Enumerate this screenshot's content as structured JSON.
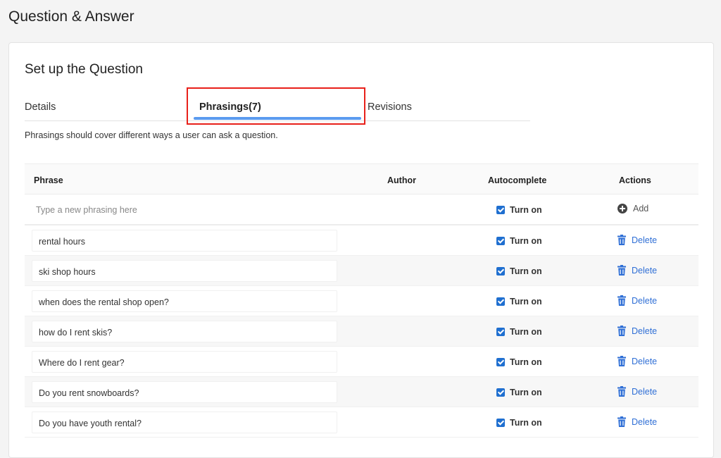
{
  "page": {
    "title": "Question & Answer"
  },
  "card": {
    "section_title": "Set up the Question",
    "tabs": [
      {
        "label": "Details"
      },
      {
        "label": "Phrasings(7)"
      },
      {
        "label": "Revisions"
      }
    ],
    "active_tab": "Phrasings(7)",
    "hint": "Phrasings should cover different ways a user can ask a question."
  },
  "table": {
    "headers": {
      "phrase": "Phrase",
      "author": "Author",
      "autocomplete": "Autocomplete",
      "actions": "Actions"
    },
    "new_row": {
      "placeholder": "Type a new phrasing here",
      "value": "",
      "autocomplete_checked": true,
      "autocomplete_label": "Turn on",
      "action_label": "Add"
    },
    "rows": [
      {
        "phrase": "rental hours",
        "author": "",
        "autocomplete_checked": true,
        "autocomplete_label": "Turn on",
        "action_label": "Delete"
      },
      {
        "phrase": "ski shop hours",
        "author": "",
        "autocomplete_checked": true,
        "autocomplete_label": "Turn on",
        "action_label": "Delete"
      },
      {
        "phrase": "when does the rental shop open?",
        "author": "",
        "autocomplete_checked": true,
        "autocomplete_label": "Turn on",
        "action_label": "Delete"
      },
      {
        "phrase": "how do I rent skis?",
        "author": "",
        "autocomplete_checked": true,
        "autocomplete_label": "Turn on",
        "action_label": "Delete"
      },
      {
        "phrase": "Where do I rent gear?",
        "author": "",
        "autocomplete_checked": true,
        "autocomplete_label": "Turn on",
        "action_label": "Delete"
      },
      {
        "phrase": "Do you rent snowboards?",
        "author": "",
        "autocomplete_checked": true,
        "autocomplete_label": "Turn on",
        "action_label": "Delete"
      },
      {
        "phrase": "Do you have youth rental?",
        "author": "",
        "autocomplete_checked": true,
        "autocomplete_label": "Turn on",
        "action_label": "Delete"
      }
    ]
  },
  "colors": {
    "accent": "#2f6fd6",
    "tab_underline": "#5b9bf0",
    "highlight": "#e8201a",
    "checkbox": "#1f6fd0"
  },
  "icons": {
    "delete": "trash-icon",
    "add": "plus-circle-icon",
    "checkbox": "checkbox-checked-icon"
  }
}
